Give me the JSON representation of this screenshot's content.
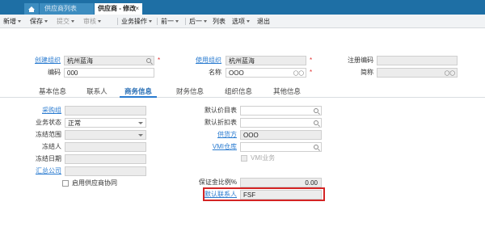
{
  "tabs": {
    "home_icon": "home-icon",
    "list": "供应商列表",
    "active": "供应商 - 修改",
    "close": "×"
  },
  "toolbar": {
    "new": "新增",
    "save": "保存",
    "submit": "提交",
    "audit": "审核",
    "business_ops": "业务操作",
    "prev": "前一",
    "next": "后一",
    "list": "列表",
    "options": "选项",
    "exit": "退出"
  },
  "header": {
    "create_org_label": "创建组织",
    "create_org_value": "杭州蓝海",
    "code_label": "编码",
    "code_value": "000",
    "use_org_label": "使用组织",
    "use_org_value": "杭州蓝海",
    "name_label": "名称",
    "name_value": "OOO",
    "reg_code_label": "注册编码",
    "reg_code_value": "",
    "short_name_label": "简称",
    "short_name_value": "",
    "required_mark": "*"
  },
  "content_tabs": [
    "基本信息",
    "联系人",
    "商务信息",
    "财务信息",
    "组织信息",
    "其他信息"
  ],
  "active_content_tab": "商务信息",
  "business": {
    "buyer_group_label": "采购组",
    "buyer_group_value": "",
    "status_label": "业务状态",
    "status_value": "正常",
    "freeze_scope_label": "冻结范围",
    "freeze_scope_value": "",
    "freezer_label": "冻结人",
    "freezer_value": "",
    "freeze_date_label": "冻结日期",
    "freeze_date_value": "",
    "settle_company_label": "汇总公司",
    "settle_company_value": "",
    "collab_label": "启用供应商协同",
    "default_price_list_label": "默认价目表",
    "default_price_list_value": "",
    "default_discount_label": "默认折扣表",
    "default_discount_value": "",
    "supplier_label": "供货方",
    "supplier_value": "OOO",
    "vmi_warehouse_label": "VMI仓库",
    "vmi_warehouse_value": "",
    "vmi_business_label": "VMI业务",
    "deposit_ratio_label": "保证金比例%",
    "deposit_ratio_value": "0.00",
    "default_contact_label": "默认联系人",
    "default_contact_value": "FSF"
  },
  "colors": {
    "accent": "#1e6fa5",
    "link": "#2a7bd0",
    "highlight": "#d42424"
  }
}
